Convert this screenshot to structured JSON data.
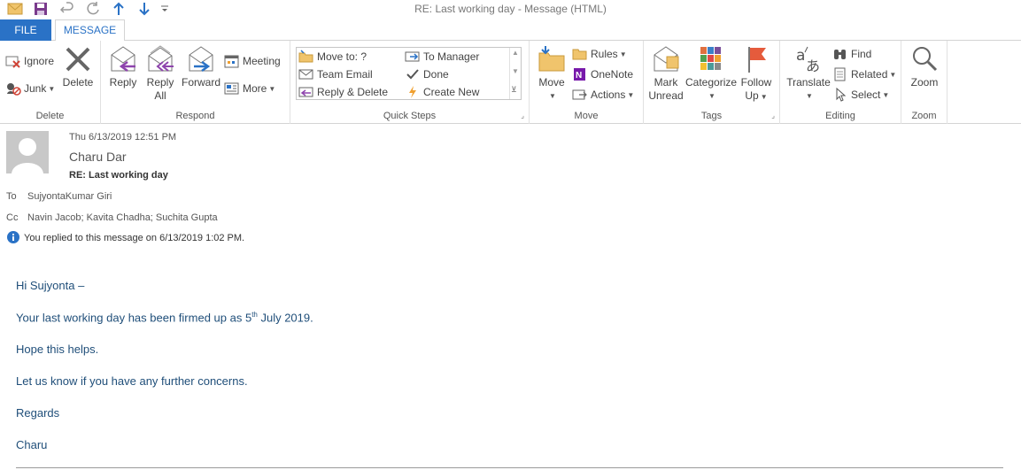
{
  "window": {
    "title": "RE: Last working day - Message (HTML)"
  },
  "tabs": {
    "file": "FILE",
    "message": "MESSAGE"
  },
  "ribbon": {
    "delete_group": {
      "label": "Delete",
      "ignore": "Ignore",
      "junk": "Junk",
      "delete": "Delete"
    },
    "respond_group": {
      "label": "Respond",
      "reply": "Reply",
      "reply_all_1": "Reply",
      "reply_all_2": "All",
      "forward": "Forward",
      "meeting": "Meeting",
      "more": "More"
    },
    "quick_steps_group": {
      "label": "Quick Steps",
      "move_to": "Move to: ?",
      "team_email": "Team Email",
      "reply_delete": "Reply & Delete",
      "to_manager": "To Manager",
      "done": "Done",
      "create_new": "Create New"
    },
    "move_group": {
      "label": "Move",
      "move": "Move",
      "rules": "Rules",
      "onenote": "OneNote",
      "actions": "Actions"
    },
    "tags_group": {
      "label": "Tags",
      "mark_unread_1": "Mark",
      "mark_unread_2": "Unread",
      "categorize": "Categorize",
      "follow_up_1": "Follow",
      "follow_up_2": "Up"
    },
    "editing_group": {
      "label": "Editing",
      "translate": "Translate",
      "find": "Find",
      "related": "Related",
      "select": "Select"
    },
    "zoom_group": {
      "label": "Zoom",
      "zoom": "Zoom"
    }
  },
  "message": {
    "date": "Thu 6/13/2019 12:51 PM",
    "sender": "Charu Dar",
    "subject": "RE: Last working day",
    "to_label": "To",
    "to": "SujyontaKumar Giri",
    "cc_label": "Cc",
    "cc": "Navin Jacob; Kavita Chadha; Suchita Gupta",
    "info": "You replied to this message on 6/13/2019 1:02 PM."
  },
  "body": {
    "greeting": "Hi Sujyonta –",
    "line1_pre": "Your last working day has been firmed up as 5",
    "line1_sup": "th",
    "line1_post": " July 2019.",
    "line2": "Hope this helps.",
    "line3": "Let us know if you have any further concerns.",
    "regards": "Regards",
    "signature": "Charu"
  },
  "colors": {
    "accent": "#2a72c6",
    "body_text": "#1f4e79"
  }
}
